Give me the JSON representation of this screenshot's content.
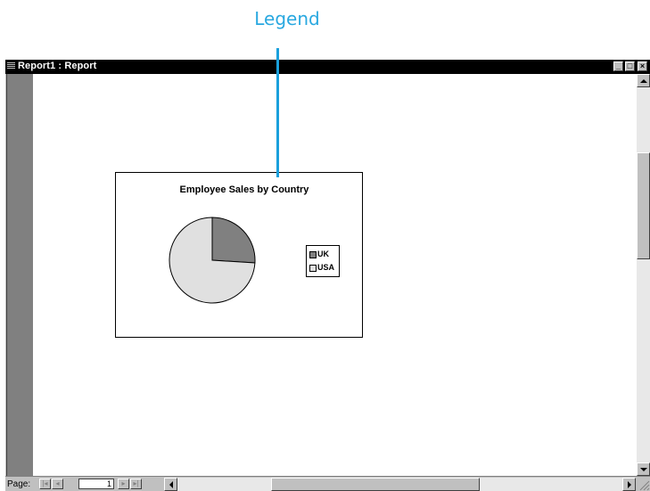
{
  "annotation": {
    "label": "Legend",
    "color": "#29a8e0"
  },
  "window": {
    "title": "Report1 : Report",
    "buttons": {
      "minimize": "_",
      "maximize": "□",
      "close": "×"
    }
  },
  "navigation": {
    "page_label": "Page:",
    "current_page": "1"
  },
  "chart_data": {
    "type": "pie",
    "title": "Employee Sales by Country",
    "categories": [
      "UK",
      "USA"
    ],
    "values": [
      26,
      74
    ],
    "colors": [
      "#808080",
      "#e0e0e0"
    ],
    "legend_position": "right"
  }
}
